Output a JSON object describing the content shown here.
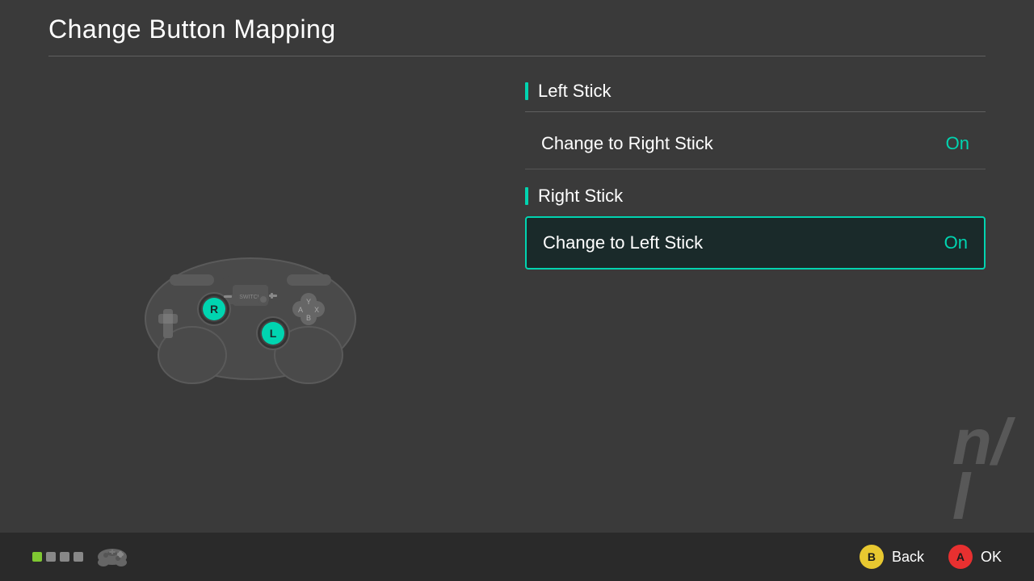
{
  "header": {
    "title": "Change Button Mapping"
  },
  "left_stick_section": {
    "title": "Left Stick",
    "options": [
      {
        "label": "Change to Right Stick",
        "value": "On",
        "selected": false
      }
    ]
  },
  "right_stick_section": {
    "title": "Right Stick",
    "options": [
      {
        "label": "Change to Left Stick",
        "value": "On",
        "selected": true
      }
    ]
  },
  "bottom_bar": {
    "back_label": "Back",
    "ok_label": "OK",
    "back_button": "B",
    "ok_button": "A"
  },
  "watermark": {
    "line1": "n",
    "line2": "l"
  }
}
